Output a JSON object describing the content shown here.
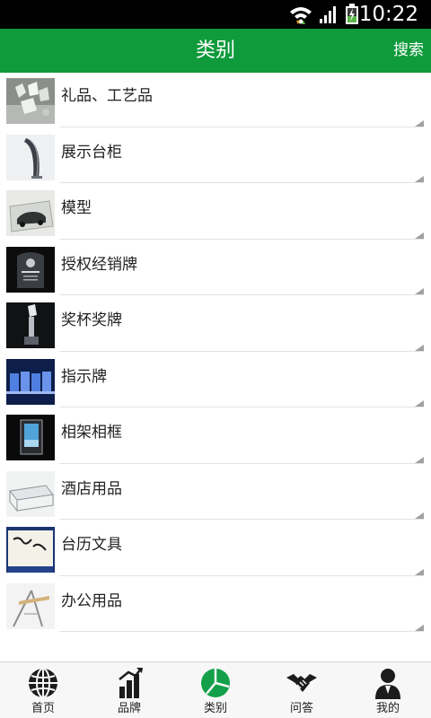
{
  "status_bar": {
    "time": "10:22",
    "icons": [
      "wifi-icon",
      "signal-icon",
      "battery-charging-icon"
    ]
  },
  "header": {
    "title": "类别",
    "search_label": "搜索"
  },
  "categories": [
    {
      "label": "礼品、工艺品",
      "icon": "crystal-crafts-thumbnail"
    },
    {
      "label": "展示台柜",
      "icon": "display-stand-thumbnail"
    },
    {
      "label": "模型",
      "icon": "car-model-thumbnail"
    },
    {
      "label": "授权经销牌",
      "icon": "dealer-plaque-thumbnail"
    },
    {
      "label": "奖杯奖牌",
      "icon": "trophy-thumbnail"
    },
    {
      "label": "指示牌",
      "icon": "sign-thumbnail"
    },
    {
      "label": "相架相框",
      "icon": "photo-frame-thumbnail"
    },
    {
      "label": "酒店用品",
      "icon": "hotel-supplies-thumbnail"
    },
    {
      "label": "台历文具",
      "icon": "desk-calendar-thumbnail"
    },
    {
      "label": "办公用品",
      "icon": "office-supplies-thumbnail"
    }
  ],
  "bottom_nav": [
    {
      "label": "首页",
      "icon": "globe-icon",
      "active": false
    },
    {
      "label": "品牌",
      "icon": "bar-chart-icon",
      "active": false
    },
    {
      "label": "类别",
      "icon": "pie-chart-icon",
      "active": true
    },
    {
      "label": "问答",
      "icon": "handshake-icon",
      "active": false
    },
    {
      "label": "我的",
      "icon": "user-icon",
      "active": false
    }
  ],
  "colors": {
    "header_green": "#0f9a3c",
    "active_tab_green": "#14a04a",
    "tab_icon_dark": "#1c1c1c"
  }
}
